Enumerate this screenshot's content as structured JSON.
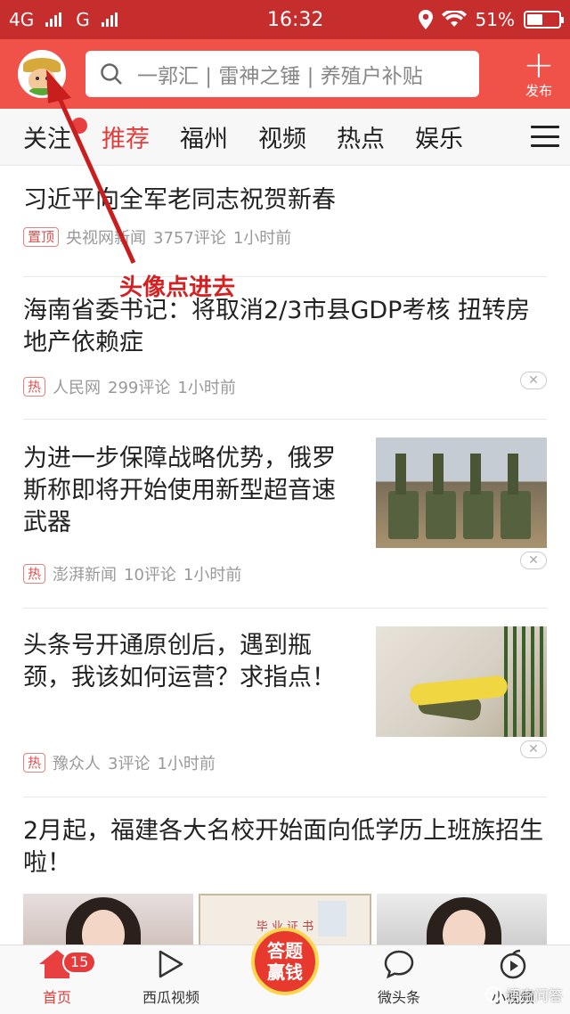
{
  "status_bar": {
    "network1": "4G",
    "network2": "G",
    "time": "16:32",
    "battery": "51%",
    "battery_level": 0.51
  },
  "header": {
    "search_placeholder": "一郭汇 | 雷神之锤 | 养殖户补贴",
    "publish_label": "发布"
  },
  "tabs": [
    "关注",
    "推荐",
    "福州",
    "视频",
    "热点",
    "娱乐"
  ],
  "active_tab": "推荐",
  "feed": [
    {
      "title": "习近平向全军老同志祝贺新春",
      "tag": "置顶",
      "source": "央视网新闻",
      "comments": "3757评论",
      "time": "1小时前"
    },
    {
      "title": "海南省委书记：将取消2/3市县GDP考核 扭转房地产依赖症",
      "tag": "热",
      "source": "人民网",
      "comments": "299评论",
      "time": "1小时前"
    },
    {
      "title": "为进一步保障战略优势，俄罗斯称即将开始使用新型超音速武器",
      "tag": "热",
      "source": "澎湃新闻",
      "comments": "10评论",
      "time": "1小时前"
    },
    {
      "title": "头条号开通原创后，遇到瓶颈，我该如何运营？求指点！",
      "tag": "热",
      "source": "豫众人",
      "comments": "3评论",
      "time": "1小时前"
    },
    {
      "title": "2月起，福建各大名校开始面向低学历上班族招生啦！"
    }
  ],
  "annotation": "头像点进去",
  "bottom_nav": {
    "home": "首页",
    "home_badge": "15",
    "xigua": "西瓜视频",
    "qa_line1": "答题",
    "qa_line2": "赢钱",
    "weitoutiao": "微头条",
    "xiaoshipin": "小视频"
  },
  "watermark": "悟空问答",
  "colors": {
    "brand_red": "#f0524a",
    "status_red": "#c62d2d",
    "accent": "#e03c3c"
  }
}
